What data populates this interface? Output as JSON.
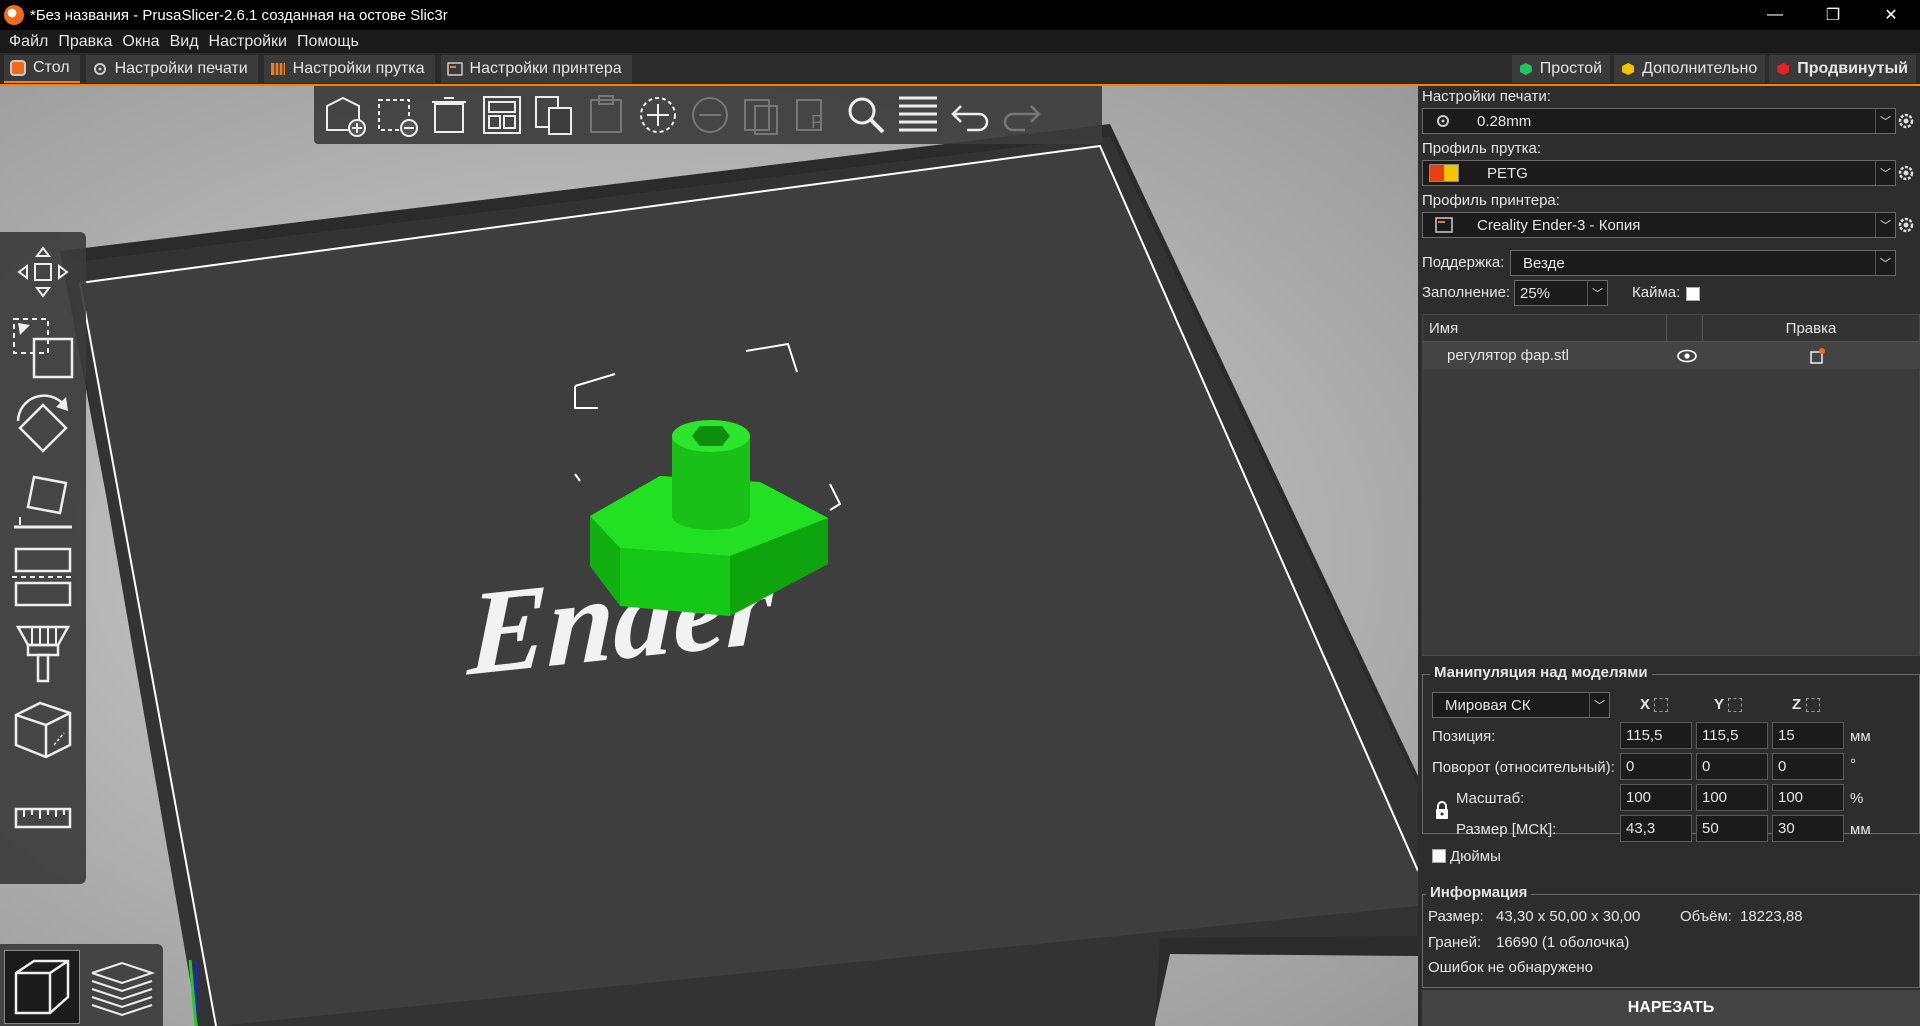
{
  "window": {
    "title": "*Без названия - PrusaSlicer-2.6.1 созданная на остове Slic3r",
    "minimize": "—",
    "restore": "❐",
    "close": "✕"
  },
  "menu": [
    "Файл",
    "Правка",
    "Окна",
    "Вид",
    "Настройки",
    "Помощь"
  ],
  "tabs": [
    {
      "label": "Стол",
      "icon": "plater-icon",
      "color": "#f26b1d"
    },
    {
      "label": "Настройки печати",
      "icon": "print-settings-icon",
      "color": "#cccccc"
    },
    {
      "label": "Настройки прутка",
      "icon": "filament-settings-icon",
      "color": "#e08030"
    },
    {
      "label": "Настройки принтера",
      "icon": "printer-settings-icon",
      "color": "#cccccc"
    }
  ],
  "modes": [
    {
      "label": "Простой",
      "color": "#22c55e"
    },
    {
      "label": "Дополнительно",
      "color": "#f5c400"
    },
    {
      "label": "Продвинутый",
      "color": "#e52222"
    }
  ],
  "viewport": {
    "bed_logo": "Ender",
    "model_color": "#19d419",
    "bed_color": "#3e3e3e"
  },
  "right_panel": {
    "print_settings_label": "Настройки печати:",
    "print_profile": "0.28mm",
    "filament_label": "Профиль прутка:",
    "filament_profile": "PETG",
    "printer_label": "Профиль принтера:",
    "printer_profile": "Creality Ender-3 - Копия",
    "support_label": "Поддержка:",
    "support_value": "Везде",
    "infill_label": "Заполнение:",
    "infill_value": "25%",
    "brim_label": "Кайма:",
    "objects": {
      "col_name": "Имя",
      "col_edit": "Правка",
      "rows": [
        {
          "name": "регулятор фар.stl"
        }
      ]
    },
    "manipulation": {
      "title": "Манипуляция над моделями",
      "coord_system": "Мировая СК",
      "axes": [
        "X",
        "Y",
        "Z"
      ],
      "position_label": "Позиция:",
      "position": [
        "115,5",
        "115,5",
        "15"
      ],
      "position_unit": "мм",
      "rotation_label": "Поворот (относительный):",
      "rotation": [
        "0",
        "0",
        "0"
      ],
      "rotation_unit": "°",
      "scale_label": "Масштаб:",
      "scale": [
        "100",
        "100",
        "100"
      ],
      "scale_unit": "%",
      "size_label": "Размер [МСК]:",
      "size": [
        "43,3",
        "50",
        "30"
      ],
      "size_unit": "мм",
      "inches_label": "Дюймы"
    },
    "info": {
      "title": "Информация",
      "size_label": "Размер:",
      "size_value": "43,30 x 50,00 x 30,00",
      "volume_label": "Объём:",
      "volume_value": "18223,88",
      "facets_label": "Граней:",
      "facets_value": "16690 (1 оболочка)",
      "errors": "Ошибок не обнаружено"
    },
    "slice_button": "НАРЕЗАТЬ"
  }
}
